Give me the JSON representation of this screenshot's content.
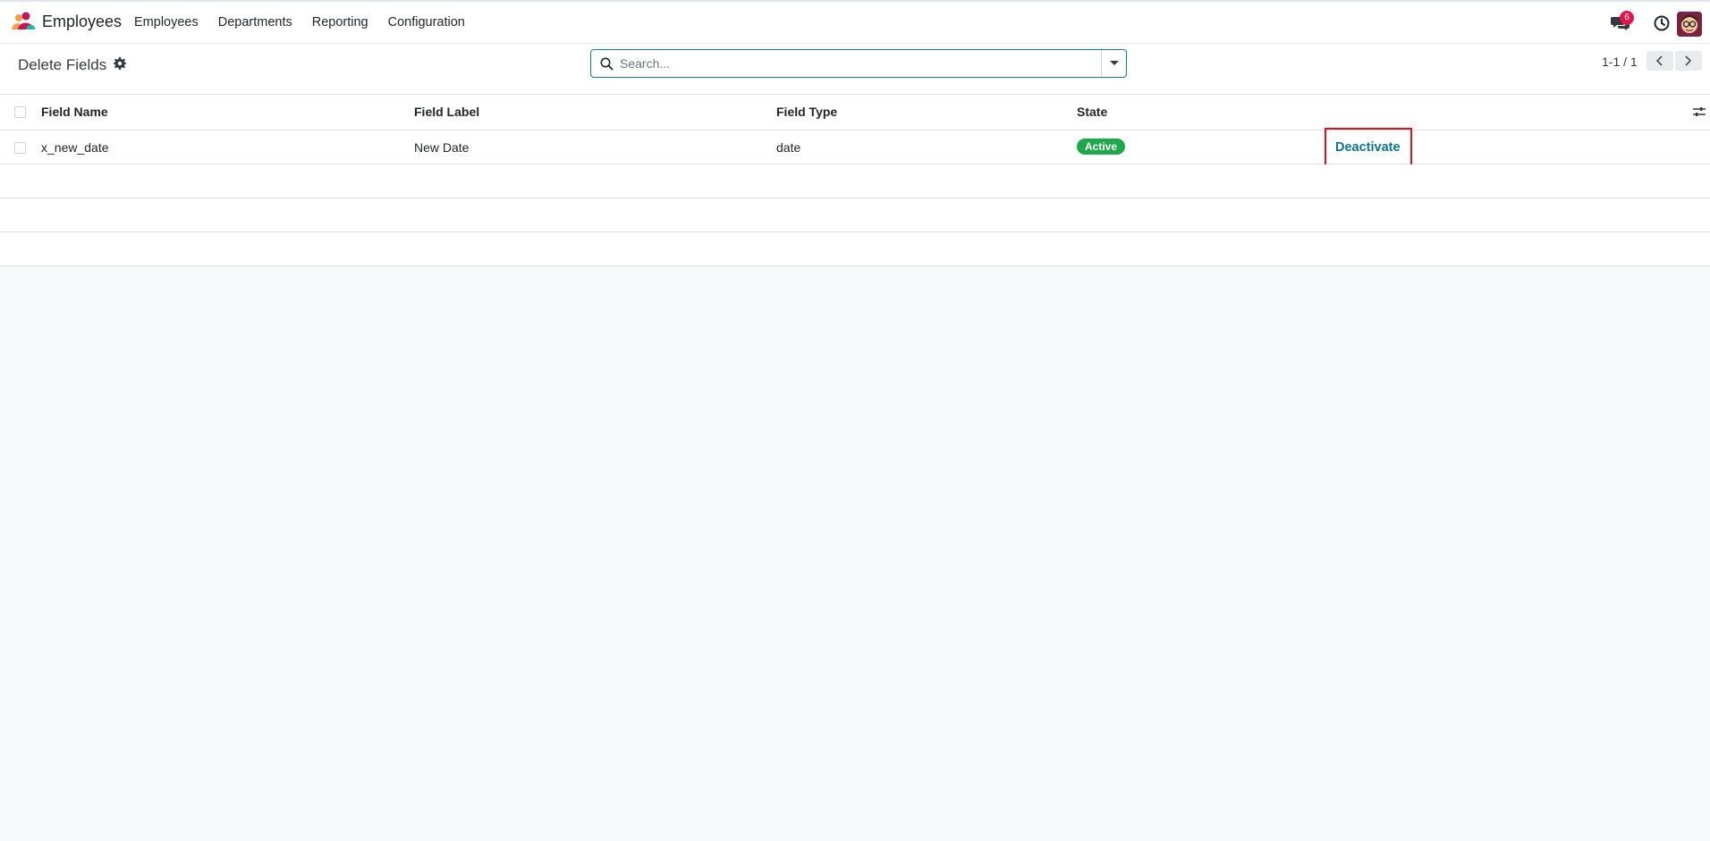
{
  "navbar": {
    "app_name": "Employees",
    "menu": [
      "Employees",
      "Departments",
      "Reporting",
      "Configuration"
    ],
    "message_count": "6"
  },
  "control_panel": {
    "title": "Delete Fields",
    "search_placeholder": "Search...",
    "pager": "1-1 / 1"
  },
  "table": {
    "columns": [
      "Field Name",
      "Field Label",
      "Field Type",
      "State"
    ],
    "rows": [
      {
        "field_name": "x_new_date",
        "field_label": "New Date",
        "field_type": "date",
        "state": "Active",
        "action": "Deactivate"
      }
    ]
  },
  "colors": {
    "accent": "#0e7490",
    "active_badge": "#1fa84b",
    "notification_badge": "#e0174a",
    "highlight_box": "#e0121a"
  },
  "icons": [
    "app-logo-icon",
    "chat-icon",
    "clock-icon",
    "avatar",
    "gear-icon",
    "search-icon",
    "caret-down-icon",
    "chevron-left-icon",
    "chevron-right-icon",
    "optional-columns-icon"
  ]
}
